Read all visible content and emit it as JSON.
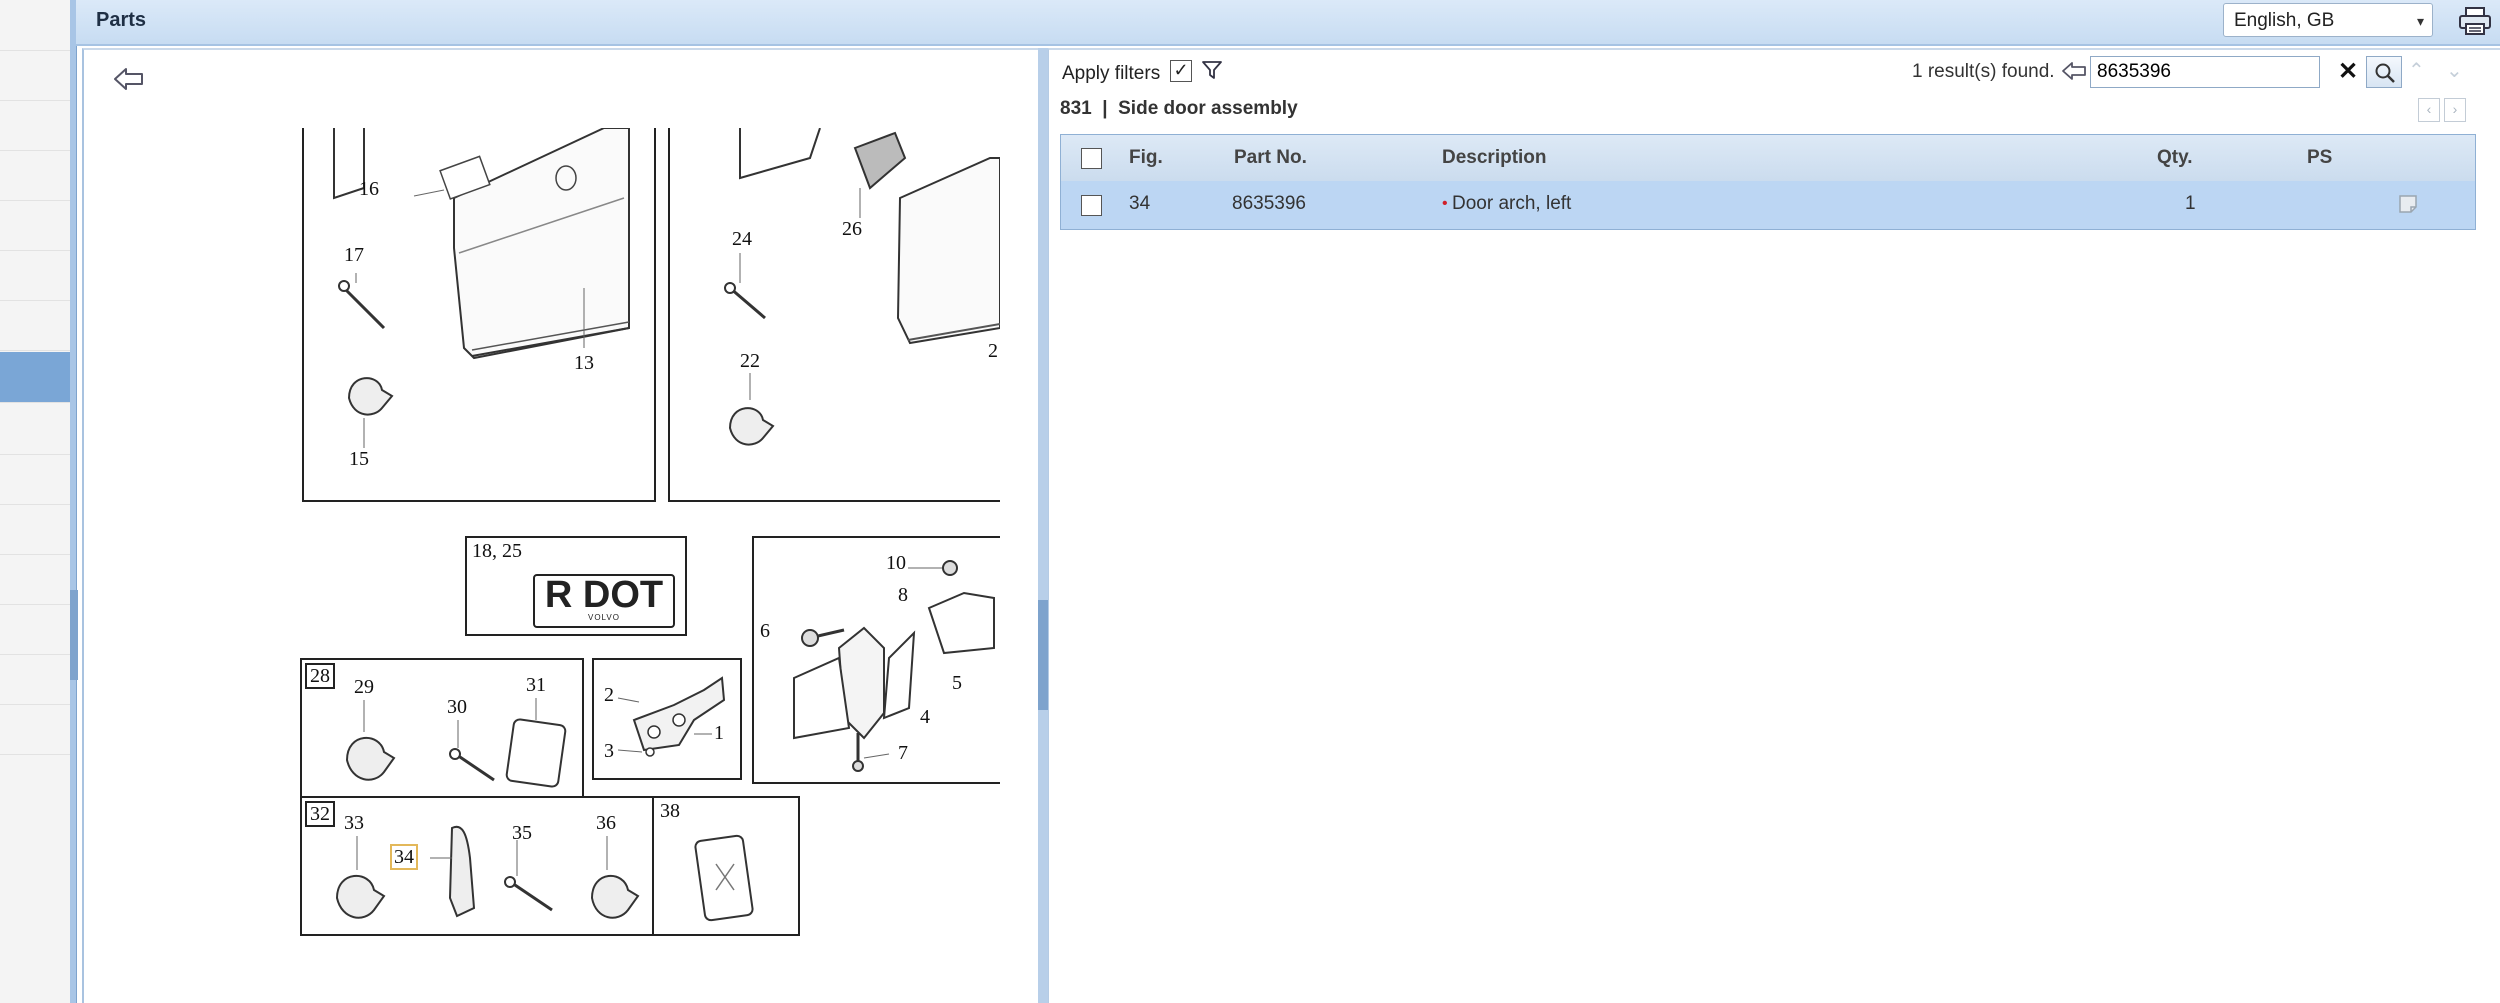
{
  "header": {
    "title": "Parts",
    "language": "English, GB"
  },
  "icons": {
    "back": "back-arrow-icon",
    "filter": "funnel-icon",
    "search": "magnifier-icon",
    "print": "printer-icon",
    "clear": "close-icon"
  },
  "filters": {
    "apply_label": "Apply filters",
    "apply_checked": true,
    "check_glyph": "✓"
  },
  "search": {
    "results_text": "1 result(s) found.",
    "value": "8635396",
    "clear_glyph": "✕"
  },
  "nav": {
    "up": "⌃",
    "down": "⌄",
    "prev": "‹",
    "next": "›"
  },
  "assembly": {
    "label": "831  |  Side door assembly"
  },
  "table": {
    "headers": {
      "fig": "Fig.",
      "part_no": "Part No.",
      "description": "Description",
      "qty": "Qty.",
      "ps": "PS"
    },
    "rows": [
      {
        "fig": "34",
        "part_no": "8635396",
        "bullet": "•",
        "description": "Door arch, left",
        "qty": "1"
      }
    ]
  },
  "diagram": {
    "callouts": [
      "16",
      "17",
      "13",
      "15",
      "24",
      "26",
      "22",
      "2",
      "18, 25",
      "R DOT",
      "VOLVO",
      "10",
      "8",
      "6",
      "5",
      "4",
      "7",
      "28",
      "29",
      "30",
      "31",
      "2",
      "1",
      "3",
      "32",
      "33",
      "34",
      "35",
      "36",
      "38"
    ]
  },
  "colors": {
    "accent": "#7aa6d6",
    "header": "#c7dcf2",
    "row_selected": "#bcd6f3",
    "highlight_box": "#e3b85a"
  }
}
